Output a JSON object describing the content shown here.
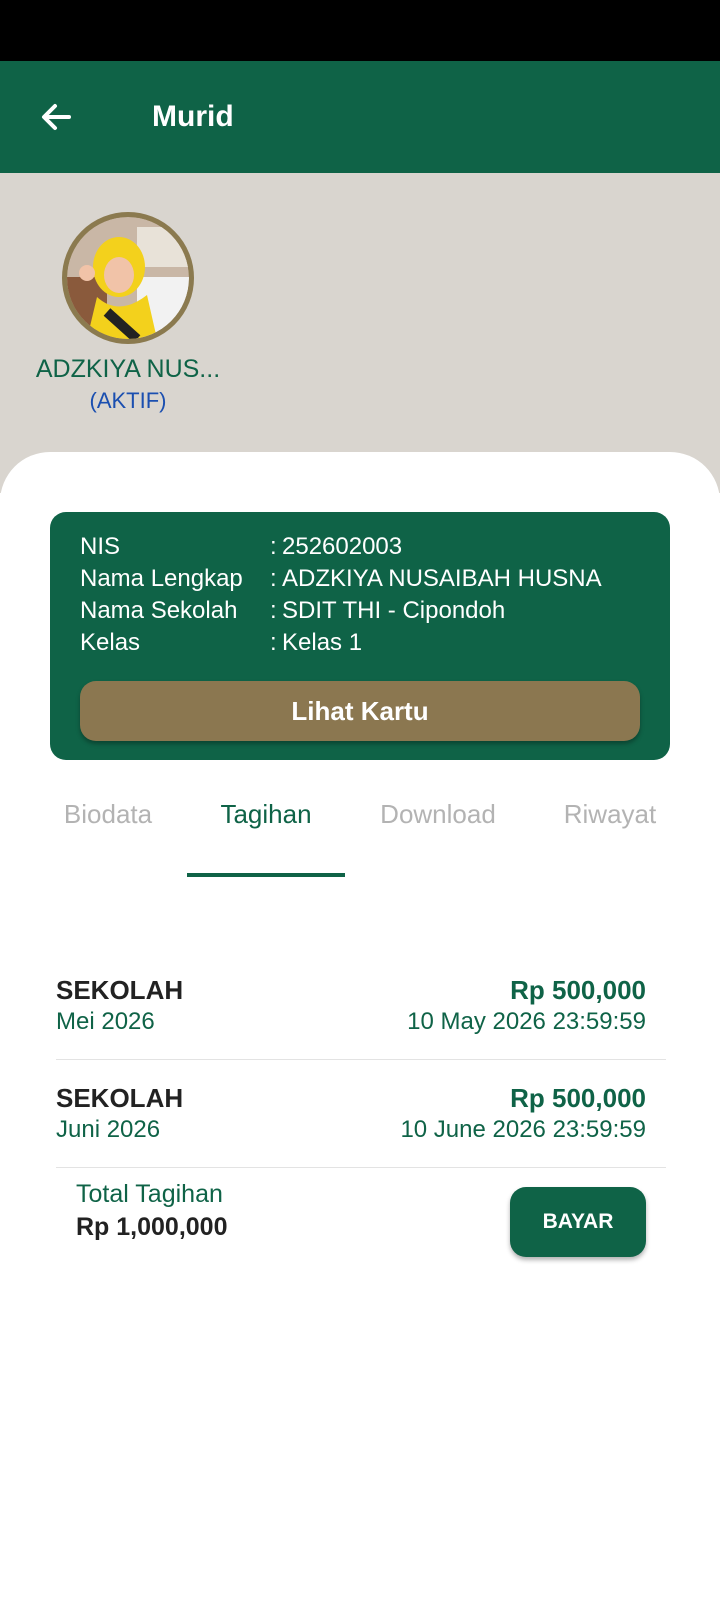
{
  "app_bar": {
    "title": "Murid"
  },
  "profile": {
    "name": "ADZKIYA NUS...",
    "status": "(AKTIF)"
  },
  "info_card": {
    "rows": [
      {
        "label": "NIS",
        "value": "252602003"
      },
      {
        "label": "Nama Lengkap",
        "value": "ADZKIYA NUSAIBAH HUSNA"
      },
      {
        "label": "Nama Sekolah",
        "value": "SDIT THI - Cipondoh"
      },
      {
        "label": "Kelas",
        "value": "Kelas 1"
      }
    ],
    "separator": ":",
    "button_label": "Lihat Kartu"
  },
  "tabs": [
    {
      "label": "Biodata",
      "active": false
    },
    {
      "label": "Tagihan",
      "active": true
    },
    {
      "label": "Download",
      "active": false
    },
    {
      "label": "Riwayat",
      "active": false
    }
  ],
  "bills": [
    {
      "title": "SEKOLAH",
      "period": "Mei 2026",
      "amount": "Rp 500,000",
      "due": "10 May 2026 23:59:59"
    },
    {
      "title": "SEKOLAH",
      "period": "Juni 2026",
      "amount": "Rp 500,000",
      "due": "10 June 2026 23:59:59"
    }
  ],
  "total": {
    "label": "Total Tagihan",
    "value": "Rp 1,000,000",
    "pay_button": "BAYAR"
  },
  "colors": {
    "primary": "#0f6347",
    "accent": "#8b7750",
    "header_bg": "#d9d5cf",
    "status_blue": "#1b4fb0"
  }
}
